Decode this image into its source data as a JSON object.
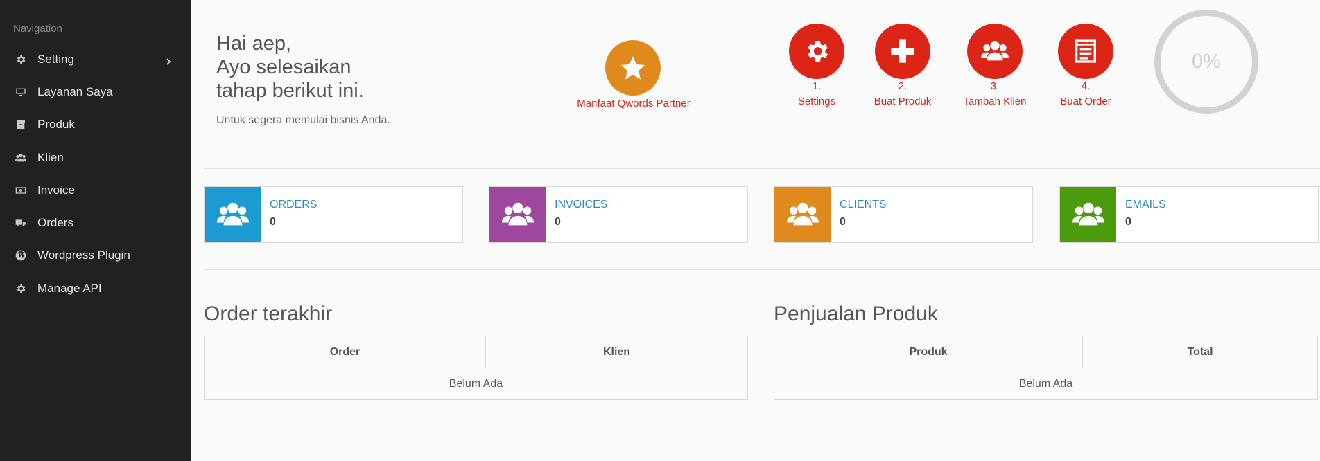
{
  "sidebar": {
    "header": "Navigation",
    "items": [
      {
        "label": "Setting",
        "icon": "gear-icon"
      },
      {
        "label": "Layanan Saya",
        "icon": "monitor-icon"
      },
      {
        "label": "Produk",
        "icon": "archive-icon"
      },
      {
        "label": "Klien",
        "icon": "users-icon"
      },
      {
        "label": "Invoice",
        "icon": "money-icon"
      },
      {
        "label": "Orders",
        "icon": "truck-icon"
      },
      {
        "label": "Wordpress Plugin",
        "icon": "wordpress-icon"
      },
      {
        "label": "Manage API",
        "icon": "gear-icon"
      }
    ]
  },
  "greeting": {
    "line1": "Hai aep,",
    "line2": "Ayo selesaikan",
    "line3": "tahap berikut ini.",
    "subtitle": "Untuk segera memulai bisnis Anda."
  },
  "partner": {
    "label": "Manfaat Qwords Partner",
    "icon": "star-icon",
    "color": "#e08a1e"
  },
  "steps": [
    {
      "number": "1.",
      "label": "Settings",
      "icon": "gear-icon"
    },
    {
      "number": "2.",
      "label": "Buat Produk",
      "icon": "plus-icon"
    },
    {
      "number": "3.",
      "label": "Tambah Klien",
      "icon": "users-icon"
    },
    {
      "number": "4.",
      "label": "Buat Order",
      "icon": "order-form-icon"
    }
  ],
  "step_color": "#dc2417",
  "progress": {
    "text": "0%",
    "value": 0
  },
  "stats": [
    {
      "label": "ORDERS",
      "value": "0",
      "color": "#1b9bd1",
      "icon": "users-icon"
    },
    {
      "label": "INVOICES",
      "value": "0",
      "color": "#9d479e",
      "icon": "users-icon"
    },
    {
      "label": "CLIENTS",
      "value": "0",
      "color": "#e08a1e",
      "icon": "users-icon"
    },
    {
      "label": "EMAILS",
      "value": "0",
      "color": "#4a9b0e",
      "icon": "users-icon"
    }
  ],
  "recent_orders": {
    "title": "Order terakhir",
    "columns": [
      "Order",
      "Klien"
    ],
    "empty_text": "Belum Ada"
  },
  "product_sales": {
    "title": "Penjualan Produk",
    "columns": [
      "Produk",
      "Total"
    ],
    "empty_text": "Belum Ada"
  }
}
